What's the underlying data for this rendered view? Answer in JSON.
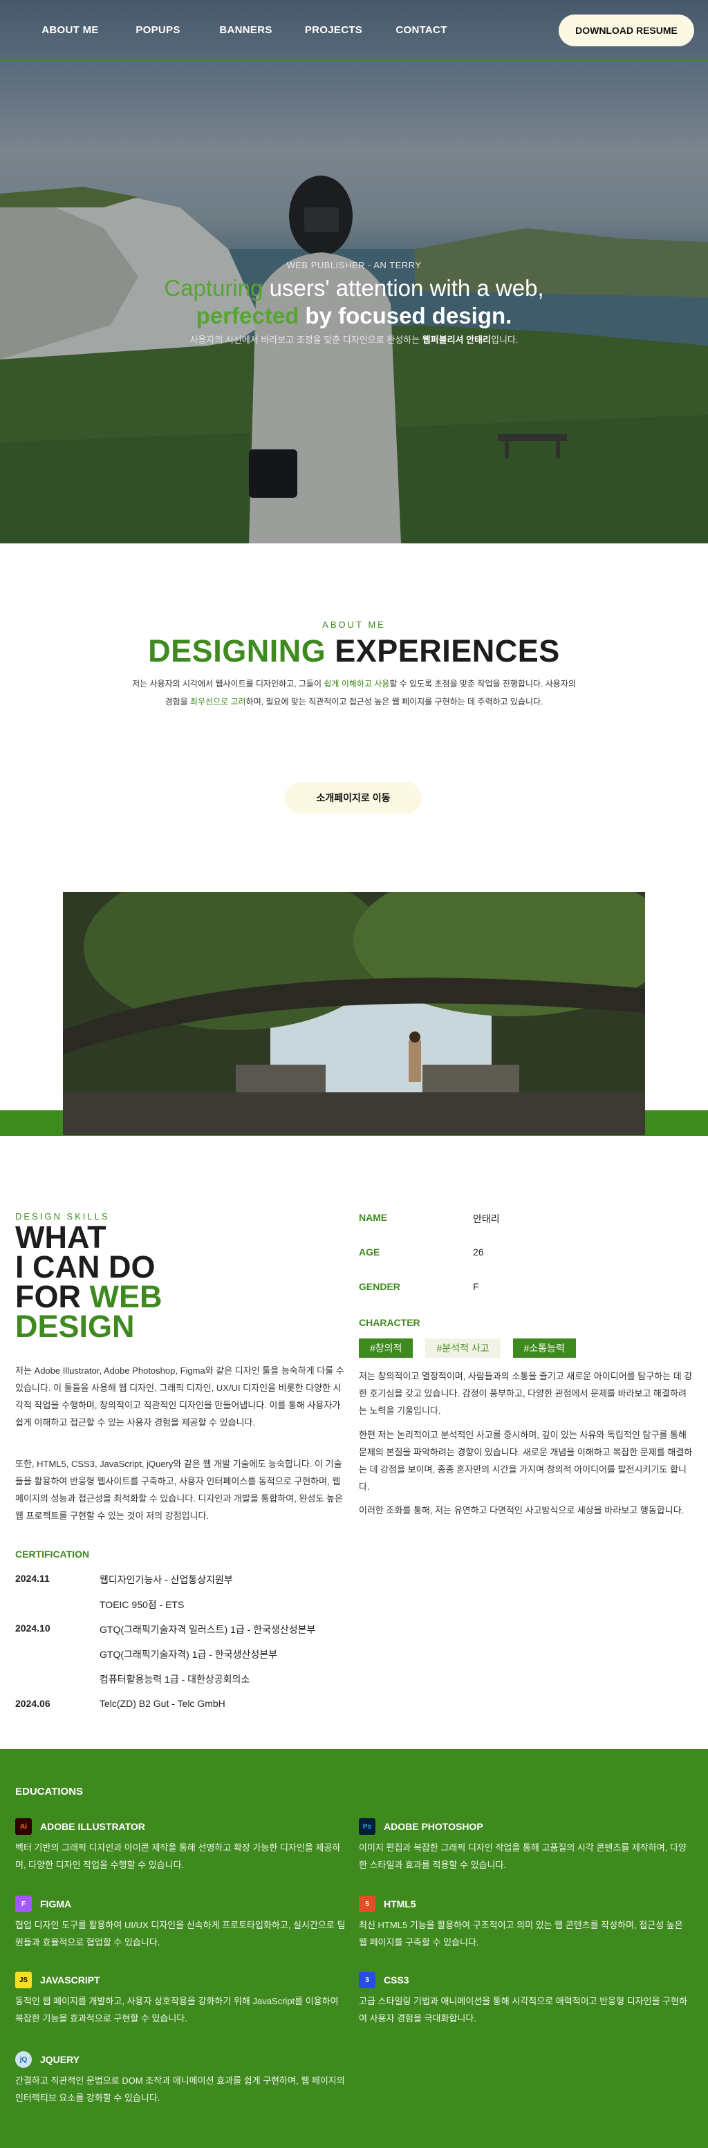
{
  "nav": {
    "links": [
      "ABOUT ME",
      "POPUPS",
      "BANNERS",
      "PROJECTS",
      "CONTACT"
    ],
    "cta": "DOWNLOAD RESUME"
  },
  "hero": {
    "subtitle": "WEB PUBLISHER - AN TERRY",
    "line1_highlight": "Capturing",
    "line1_rest": " users' attention with a web,",
    "line2_highlight": "perfected",
    "line2_rest": " by focused design.",
    "desc_pre": "사용자의 시선에서 바라보고 조정을 맞춘 디자인으로 완성하는 ",
    "desc_bold": "웹퍼블리셔 안태리",
    "desc_post": "입니다."
  },
  "about": {
    "label": "ABOUT ME",
    "title_green": "DESIGNING",
    "title_rest": " EXPERIENCES",
    "desc1_pre": "저는 사용자의 시각에서 웹사이트를 디자인하고, 그들이 ",
    "desc1_green": "쉽게 이해하고 사용",
    "desc1_post": "할 수 있도록 초점을 맞춘 작업을 진행합니다. 사용자의",
    "desc2_pre": "경험을 ",
    "desc2_green": "최우선으로 고려",
    "desc2_post": "하며, 필요에 맞는 직관적이고 접근성 높은 웹 페이지를 구현하는 데 주력하고 있습니다.",
    "button": "소개페이지로 이동"
  },
  "skills": {
    "label": "DESIGN SKILLS",
    "title_lines": [
      "WHAT",
      "I CAN DO",
      "FOR "
    ],
    "title_green1": "WEB",
    "title_green2": "DESIGN",
    "p1": "저는 Adobe Illustrator, Adobe Photoshop, Figma와 같은 디자인 툴을 능숙하게 다룰 수 있습니다. 이 툴들을 사용해 웹 디자인, 그래픽 디자인, UX/UI 디자인을 비롯한 다양한 시각적 작업을 수행하며, 창의적이고 직관적인 디자인을 만들어냅니다. 이를 통해 사용자가 쉽게 이해하고 접근할 수 있는 사용자 경험을 제공할 수 있습니다.",
    "p2": "또한, HTML5, CSS3, JavaScript, jQuery와 같은 웹 개발 기술에도 능숙합니다. 이 기술들을 활용하여 반응형 웹사이트를 구축하고, 사용자 인터페이스를 동적으로 구현하며, 웹 페이지의 성능과 접근성을 최적화할 수 있습니다. 디자인과 개발을 통합하여, 완성도 높은 웹 프로젝트를 구현할 수 있는 것이 저의 강점입니다."
  },
  "certification": {
    "title": "CERTIFICATION",
    "rows": [
      {
        "year": "2024.11",
        "text": "웹디자인기능사 - 산업통상지원부"
      },
      {
        "year": "",
        "text": "TOEIC 950점 - ETS"
      },
      {
        "year": "2024.10",
        "text": "GTQ(그래픽기술자격 일러스트) 1급 - 한국생산성본부"
      },
      {
        "year": "",
        "text": "GTQ(그래픽기술자격) 1급 - 한국생산성본부"
      },
      {
        "year": "",
        "text": "컴퓨터활용능력 1급 - 대한상공회의소"
      },
      {
        "year": "2024.06",
        "text": "Telc(ZD) B2 Gut - Telc GmbH"
      }
    ]
  },
  "profile": {
    "rows": [
      {
        "key": "NAME",
        "value": "안태리"
      },
      {
        "key": "AGE",
        "value": "26"
      },
      {
        "key": "GENDER",
        "value": "F"
      }
    ],
    "character_label": "CHARACTER",
    "tags": [
      "#창의적",
      "#분석적 사고",
      "#소통능력"
    ],
    "p1": "저는 창의적이고 열정적이며, 사람들과의 소통을 즐기고 새로운 아이디어를 탐구하는 데 강한 호기심을 갖고 있습니다. 감정이 풍부하고, 다양한 관점에서 문제를 바라보고 해결하려는 노력을 기울입니다.",
    "p2": "한편 저는 논리적이고 분석적인 사고를 중시하며, 깊이 있는 사유와 독립적인 탐구를 통해 문제의 본질을 파악하려는 경향이 있습니다. 새로운 개념을 이해하고 복잡한 문제를 해결하는 데 강점을 보이며, 종종 혼자만의 시간을 가지며 창의적 아이디어를 발전시키기도 합니다.",
    "p3": "이러한 조화를 통해, 저는 유연하고 다면적인 사고방식으로 세상을 바라보고 행동합니다."
  },
  "educations": {
    "title": "EDUCATIONS",
    "items": [
      {
        "icon": "Ai",
        "icon_color": "#ff7c00",
        "icon_bg": "#300000",
        "name": "ADOBE ILLUSTRATOR",
        "desc": "벡터 기반의 그래픽 디자인과 아이콘 제작을 통해 선명하고 확장 가능한 디자인을 제공하며, 다양한 디자인 작업을 수행할 수 있습니다."
      },
      {
        "icon": "Ps",
        "icon_color": "#31a8ff",
        "icon_bg": "#001e36",
        "name": "ADOBE PHOTOSHOP",
        "desc": "이미지 편집과 복잡한 그래픽 디자인 작업을 통해 고품질의 시각 콘텐츠를 제작하며, 다양한 스타일과 효과를 적용할 수 있습니다."
      },
      {
        "icon": "F",
        "icon_color": "#ffffff",
        "icon_bg": "#a259ff",
        "name": "FIGMA",
        "desc": "협업 디자인 도구를 활용하여 UI/UX 디자인을 신속하게 프로토타입화하고, 실시간으로 팀원들과 효율적으로 협업할 수 있습니다."
      },
      {
        "icon": "5",
        "icon_color": "#ffffff",
        "icon_bg": "#e44d26",
        "name": "HTML5",
        "desc": "최신 HTML5 기능을 활용하여 구조적이고 의미 있는 웹 콘텐츠를 작성하며, 접근성 높은 웹 페이지를 구축할 수 있습니다."
      },
      {
        "icon": "JS",
        "icon_color": "#000000",
        "icon_bg": "#f7df1e",
        "name": "JAVASCRIPT",
        "desc": "동적인 웹 페이지를 개발하고, 사용자 상호작용을 강화하기 위해 JavaScript를 이용하여 복잡한 기능을 효과적으로 구현할 수 있습니다."
      },
      {
        "icon": "3",
        "icon_color": "#ffffff",
        "icon_bg": "#264de4",
        "name": "CSS3",
        "desc": "고급 스타일링 기법과 애니메이션을 통해 시각적으로 매력적이고 반응형 디자인을 구현하여 사용자 경험을 극대화합니다."
      },
      {
        "icon": "jQ",
        "icon_color": "#0769ad",
        "icon_bg": "#cfe3f3",
        "name": "JQUERY",
        "desc": "간결하고 직관적인 문법으로 DOM 조작과 애니메이션 효과를 쉽게 구현하며, 웹 페이지의 인터랙티브 요소를 강화할 수 있습니다."
      }
    ]
  }
}
